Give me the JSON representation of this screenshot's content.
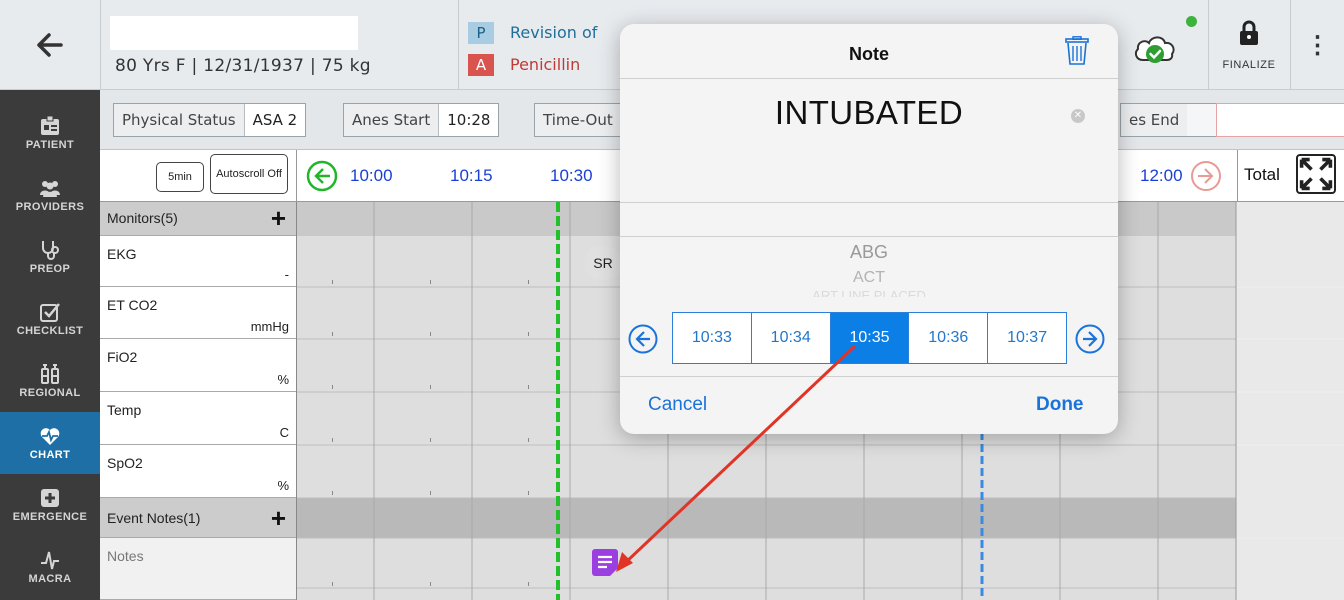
{
  "header": {
    "back_icon": "arrow-left-icon",
    "patient_info": "80 Yrs F | 12/31/1937 | 75 kg",
    "procedure_badge": "P",
    "procedure_text": "Revision of",
    "allergy_badge": "A",
    "allergy_text": "Penicillin",
    "cloud_icon": "cloud-check-icon",
    "finalize_label": "FINALIZE",
    "more_icon": "⋮",
    "sync_color": "#3cb43c"
  },
  "sidebar": {
    "items": [
      {
        "label": "PATIENT",
        "icon": "id-badge-icon"
      },
      {
        "label": "PROVIDERS",
        "icon": "people-icon"
      },
      {
        "label": "PREOP",
        "icon": "stethoscope-icon"
      },
      {
        "label": "CHECKLIST",
        "icon": "checkbox-icon"
      },
      {
        "label": "REGIONAL",
        "icon": "syringe-icon"
      },
      {
        "label": "CHART",
        "icon": "heart-pulse-icon"
      },
      {
        "label": "EMERGENCE",
        "icon": "plus-square-icon"
      },
      {
        "label": "MACRA",
        "icon": "pulse-icon"
      }
    ],
    "active": "CHART"
  },
  "status_bar": {
    "physical_status_label": "Physical Status",
    "physical_status_value": "ASA 2",
    "anes_start_label": "Anes Start",
    "anes_start_value": "10:28",
    "time_out_label": "Time-Out",
    "anes_end_label": "es End"
  },
  "timeline": {
    "interval_btn": "5min",
    "autoscroll_btn": "Autoscroll Off",
    "times": [
      "10:00",
      "10:15",
      "10:30"
    ],
    "end_time": "12:00",
    "total_label": "Total"
  },
  "grid": {
    "monitors_header": "Monitors(5)",
    "rows": [
      {
        "name": "EKG",
        "unit": "-"
      },
      {
        "name": "ET CO2",
        "unit": "mmHg"
      },
      {
        "name": "FiO2",
        "unit": "%"
      },
      {
        "name": "Temp",
        "unit": "C"
      },
      {
        "name": "SpO2",
        "unit": "%"
      }
    ],
    "event_header": "Event Notes(1)",
    "notes_label": "Notes",
    "rhythm_tag": "SR",
    "anes_start_line_color": "#22c02a",
    "marker_line_color": "#3b8ae0",
    "note_marker_color": "#9b3fe0"
  },
  "note_modal": {
    "title": "Note",
    "note_text": "INTUBATED",
    "picker_items": [
      "ABG",
      "ACT",
      "ART LINE PLACED"
    ],
    "times": [
      "10:33",
      "10:34",
      "10:35",
      "10:36",
      "10:37"
    ],
    "selected_time": "10:35",
    "cancel_label": "Cancel",
    "done_label": "Done",
    "accent_color": "#0b7fe6"
  },
  "annotation": {
    "arrow_color": "#e03426"
  }
}
